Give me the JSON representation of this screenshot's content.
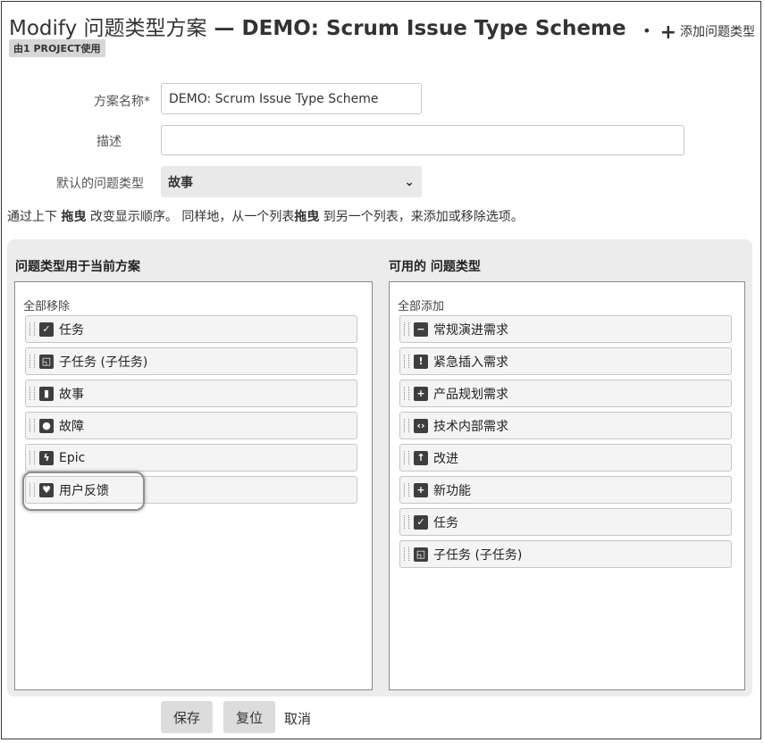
{
  "header": {
    "title_prefix": "Modify 问题类型方案",
    "title_dash": " — ",
    "title_scheme": "DEMO: Scrum Issue Type Scheme",
    "usage_badge": "由1 PROJECT使用",
    "add_bullet": "•",
    "add_plus": "+",
    "add_label": "添加问题类型"
  },
  "form": {
    "name_label": "方案名称*",
    "name_value": "DEMO: Scrum Issue Type Scheme",
    "desc_label": "描述",
    "desc_value": "",
    "default_label": "默认的问题类型",
    "default_value": "故事",
    "chevron": "⌄"
  },
  "hint": {
    "part1": "通过上下 ",
    "drag1": "拖曳",
    "part2": " 改变显示顺序。 同样地，从一个列表",
    "drag2": "拖曳",
    "part3": " 到另一个列表，来添加或移除选项。"
  },
  "current": {
    "title": "问题类型用于当前方案",
    "action": "全部移除",
    "items": [
      {
        "label": "任务",
        "icon": "check-icon",
        "glyph": "✓"
      },
      {
        "label": "子任务 (子任务)",
        "icon": "subtask-icon",
        "glyph": "◱"
      },
      {
        "label": "故事",
        "icon": "bookmark-icon",
        "glyph": "▮"
      },
      {
        "label": "故障",
        "icon": "bug-icon",
        "glyph": "●"
      },
      {
        "label": "Epic",
        "icon": "lightning-icon",
        "glyph": "ϟ"
      },
      {
        "label": "用户反馈",
        "icon": "heart-icon",
        "glyph": "♥"
      }
    ]
  },
  "available": {
    "title": "可用的 问题类型",
    "action": "全部添加",
    "items": [
      {
        "label": "常规演进需求",
        "icon": "minus-icon",
        "glyph": "−"
      },
      {
        "label": "紧急插入需求",
        "icon": "exclamation-icon",
        "glyph": "!"
      },
      {
        "label": "产品规划需求",
        "icon": "plus-icon",
        "glyph": "+"
      },
      {
        "label": "技术内部需求",
        "icon": "code-icon",
        "glyph": "‹›"
      },
      {
        "label": "改进",
        "icon": "arrow-up-icon",
        "glyph": "↑"
      },
      {
        "label": "新功能",
        "icon": "plus-icon",
        "glyph": "+"
      },
      {
        "label": "任务",
        "icon": "check-icon",
        "glyph": "✓"
      },
      {
        "label": "子任务 (子任务)",
        "icon": "subtask-icon",
        "glyph": "◱"
      }
    ]
  },
  "buttons": {
    "save": "保存",
    "reset": "复位",
    "cancel": "取消"
  }
}
